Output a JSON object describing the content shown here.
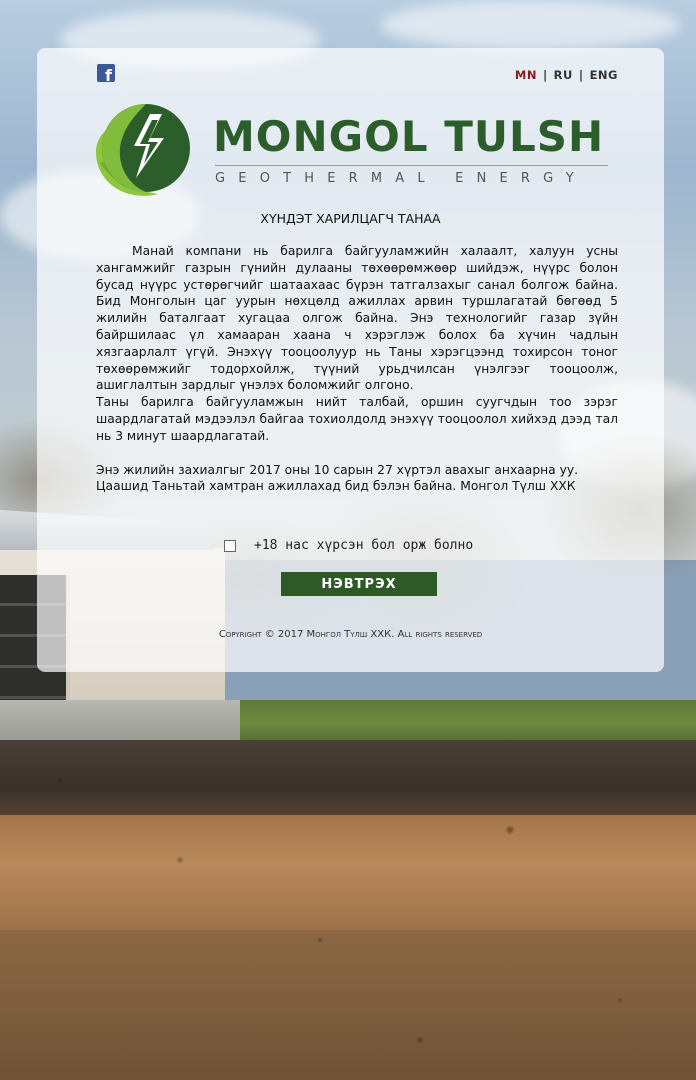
{
  "header": {
    "facebook_icon": "facebook-icon",
    "languages": [
      {
        "code": "MN",
        "active": true
      },
      {
        "code": "RU",
        "active": false
      },
      {
        "code": "ENG",
        "active": false
      }
    ],
    "separator": "|"
  },
  "brand": {
    "name": "MONGOL TULSH",
    "tagline": "GEOTHERMAL ENERGY",
    "logo_icon": "leaf-lightning-logo",
    "colors": {
      "dark_green": "#2c5e2c",
      "light_green": "#8dc63f"
    }
  },
  "content": {
    "greeting": "ХҮНДЭТ ХАРИЛЦАГЧ ТАНАА",
    "paragraph_1": "Манай компани нь барилга байгууламжийн халаалт, халуун усны хангамжийг газрын гүнийн дулааны төхөөрөмжөөр шийдэж, нүүрс болон бусад нүүрс устөрөгчийг шатаахаас бүрэн татгалзахыг санал болгож байна. Бид Монголын цаг уурын нөхцөлд ажиллах арвин туршлагатай бөгөөд 5 жилийн баталгаат хугацаа олгож байна. Энэ технологийг газар зүйн байршилаас үл хамааран хаана ч хэрэглэж болох ба хүчин чадлын хязгаарлалт үгүй. Энэхүү тооцоолуур нь Таны хэрэгцээнд тохирсон тоног төхөөрөмжийг тодорхойлж, түүний урьдчилсан үнэлгээг тооцоолж, ашиглалтын зардлыг үнэлэх боломжийг олгоно.",
    "paragraph_2": "Таны барилга байгууламжын нийт талбай, оршин суугчдын тоо зэрэг шаардлагатай мэдээлэл байгаа тохиолдолд энэхүү тооцоолол хийхэд дээд тал нь 3 минут шаардлагатай.",
    "paragraph_3": "Энэ жилийн захиалгыг 2017 оны 10 сарын 27 хүртэл авахыг анхаарна уу.",
    "paragraph_4": "Цаашид Таньтай хамтран ажиллахад бид бэлэн байна. Монгол Түлш ХХК"
  },
  "age_confirm": {
    "label": "+18 нас хүрсэн бол орж болно",
    "checked": false
  },
  "enter_button": {
    "label": "НЭВТРЭХ",
    "color": "#2d5a27"
  },
  "footer": {
    "copyright": "Copyright © 2017  Монгол Түлш ХХК. All rights reserved"
  }
}
